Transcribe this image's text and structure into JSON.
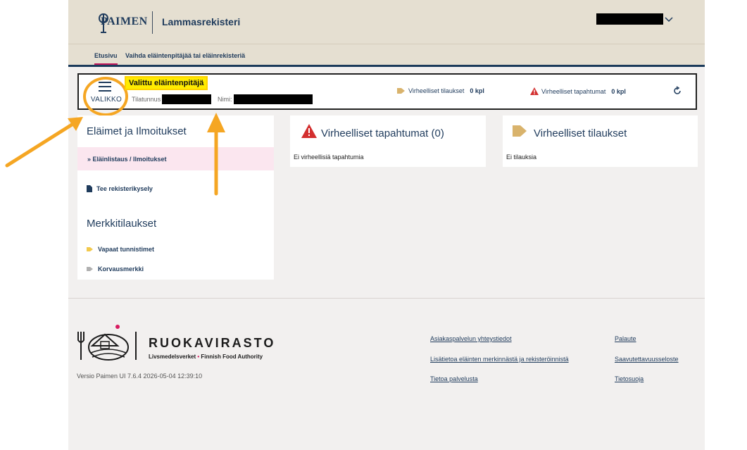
{
  "header": {
    "logo_text": "PAIMEN",
    "app_title": "Lammasrekisteri",
    "colors": {
      "background": "#e5dfd1",
      "primary": "#1f3b5c",
      "accent": "#c2185b"
    }
  },
  "nav": {
    "tabs": [
      {
        "label": "Etusivu",
        "active": true
      },
      {
        "label": "Vaihda eläintenpitäjää tai eläinrekisteriä",
        "active": false
      }
    ]
  },
  "selected_holder": {
    "menu_label": "VALIKKO",
    "title": "Valittu eläintenpitäjä",
    "farm_label": "Tilatunnus",
    "name_label": "Nimi:",
    "orders_error_label": "Virheelliset tilaukset",
    "orders_error_count": "0 kpl",
    "events_error_label": "Virheelliset tapahtumat",
    "events_error_count": "0 kpl"
  },
  "sidebar": {
    "section1_title": "Eläimet ja Ilmoitukset",
    "active_item": "Eläinlistaus / Ilmoitukset",
    "item_query": "Tee rekisterikysely",
    "section2_title": "Merkkitilaukset",
    "item_free_tags": "Vapaat tunnistimet",
    "item_replacement": "Korvausmerkki"
  },
  "cards": {
    "events": {
      "title": "Virheelliset tapahtumat (0)",
      "text": "Ei virheellisiä tapahtumia"
    },
    "orders": {
      "title": "Virheelliset tilaukset",
      "text": "Ei tilauksia"
    }
  },
  "footer": {
    "org_name": "RUOKAVIRASTO",
    "org_sub_left": "Livsmedelsverket",
    "org_sub_right": "Finnish Food Authority",
    "version": "Versio Paimen UI 7.6.4 2026-05-04 12:39:10",
    "links_col1": [
      "Asiakaspalvelun yhteystiedot",
      "Lisätietoa eläinten merkinnästä ja rekisteröinnistä",
      "Tietoa palvelusta"
    ],
    "links_col2": [
      "Palaute",
      "Saavutettavuusseloste",
      "Tietosuoja"
    ]
  },
  "annotation_color": "#f5a623"
}
